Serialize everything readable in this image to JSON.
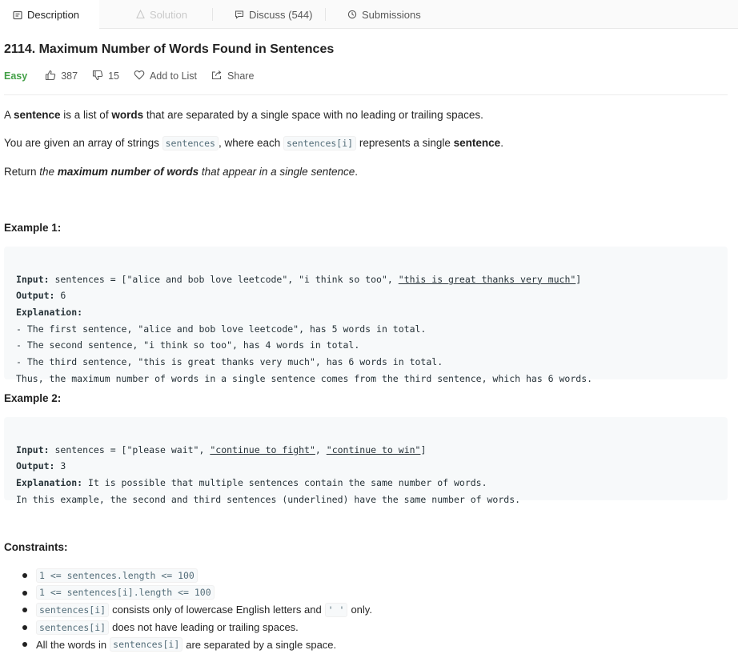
{
  "tabs": [
    {
      "label": "Description",
      "icon": "description-icon",
      "state": "active"
    },
    {
      "label": "Solution",
      "icon": "solution-icon",
      "state": "disabled"
    },
    {
      "label": "Discuss (544)",
      "icon": "discuss-icon",
      "state": "normal"
    },
    {
      "label": "Submissions",
      "icon": "submissions-icon",
      "state": "normal"
    }
  ],
  "problem": {
    "title": "2114. Maximum Number of Words Found in Sentences",
    "difficulty": "Easy",
    "likes": "387",
    "dislikes": "15",
    "add_to_list": "Add to List",
    "share": "Share"
  },
  "description": {
    "p1": {
      "t1": "A ",
      "b1": "sentence",
      "t2": " is a list of ",
      "b2": "words",
      "t3": " that are separated by a single space with no leading or trailing spaces."
    },
    "p2": {
      "t1": "You are given an array of strings ",
      "c1": "sentences",
      "t2": ", where each ",
      "c2": "sentences[i]",
      "t3": " represents a single ",
      "b1": "sentence",
      "t4": "."
    },
    "p3": {
      "t1": "Return ",
      "i1": "the ",
      "bi1": "maximum number of words",
      "i2": " that appear in a single sentence",
      "t2": "."
    }
  },
  "example1": {
    "heading": "Example 1:",
    "input_label": "Input:",
    "input_prefix": " sentences = [\"alice and bob love leetcode\", \"i think so too\", ",
    "input_underlined": "\"this is great thanks very much\"",
    "input_suffix": "]",
    "output_label": "Output:",
    "output_value": " 6",
    "explanation_label": "Explanation:",
    "lines": [
      "- The first sentence, \"alice and bob love leetcode\", has 5 words in total.",
      "- The second sentence, \"i think so too\", has 4 words in total.",
      "- The third sentence, \"this is great thanks very much\", has 6 words in total.",
      "Thus, the maximum number of words in a single sentence comes from the third sentence, which has 6 words."
    ]
  },
  "example2": {
    "heading": "Example 2:",
    "input_label": "Input:",
    "input_prefix": " sentences = [\"please wait\", ",
    "input_underlined_1": "\"continue to fight\"",
    "input_mid": ", ",
    "input_underlined_2": "\"continue to win\"",
    "input_suffix": "]",
    "output_label": "Output:",
    "output_value": " 3",
    "explanation_label": "Explanation:",
    "explanation_text": " It is possible that multiple sentences contain the same number of words.",
    "line2": "In this example, the second and third sentences (underlined) have the same number of words."
  },
  "constraints": {
    "heading": "Constraints:",
    "c1": "1 <= sentences.length <= 100",
    "c2": "1 <= sentences[i].length <= 100",
    "c3": {
      "code1": "sentences[i]",
      "t1": "consists only of lowercase English letters and",
      "code2": "' '",
      "t2": "only."
    },
    "c4": {
      "code1": "sentences[i]",
      "t1": "does not have leading or trailing spaces."
    },
    "c5": {
      "t1": "All the words in",
      "code1": "sentences[i]",
      "t2": "are separated by a single space."
    }
  }
}
